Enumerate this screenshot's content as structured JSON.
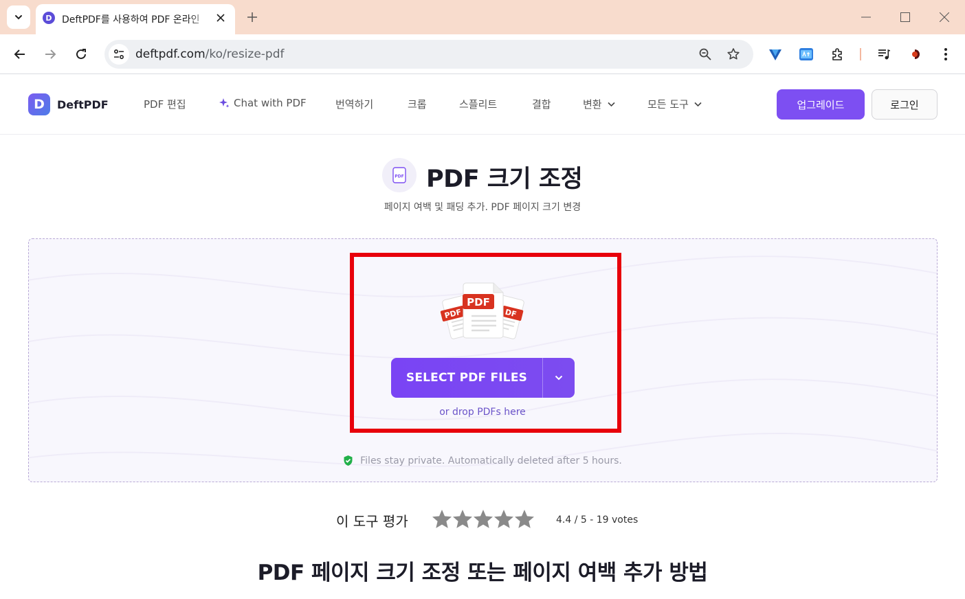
{
  "browser": {
    "tab_title": "DeftPDF를 사용하여 PDF 온라인",
    "favicon_letter": "D",
    "url_host": "deftpdf.com",
    "url_path": "/ko/resize-pdf"
  },
  "header": {
    "brand_name": "DeftPDF",
    "brand_letter": "D",
    "nav": {
      "edit": "PDF 편집",
      "chat": "Chat with PDF",
      "translate": "번역하기",
      "crop": "크롭",
      "split": "스플리트",
      "merge": "결합",
      "convert": "변환",
      "all_tools": "모든 도구"
    },
    "upgrade_label": "업그레이드",
    "login_label": "로그인"
  },
  "main": {
    "title": "PDF 크기 조정",
    "title_icon_text": "PDF",
    "subtitle": "페이지 여백 및 패딩 추가. PDF 페이지 크기 변경",
    "upload": {
      "illustration_label_front": "PDF",
      "illustration_label_left": "PDF",
      "illustration_label_right": "DF",
      "select_label": "SELECT PDF FILES",
      "drop_hint": "or drop PDFs here",
      "privacy_note": "Files stay private. Automatically deleted after 5 hours."
    },
    "rating": {
      "label": "이 도구 평가",
      "score_text": "4.4 / 5 - 19 votes",
      "score": 4.4,
      "max": 5,
      "votes": 19
    },
    "howto_heading": "PDF 페이지 크기 조정 또는 페이지 여백 추가 방법"
  },
  "colors": {
    "accent": "#7d4ff2",
    "tabstrip": "#f8dccd",
    "highlight": "#e8000b",
    "pdf_red": "#d8321f",
    "star": "#8a8a8a"
  }
}
